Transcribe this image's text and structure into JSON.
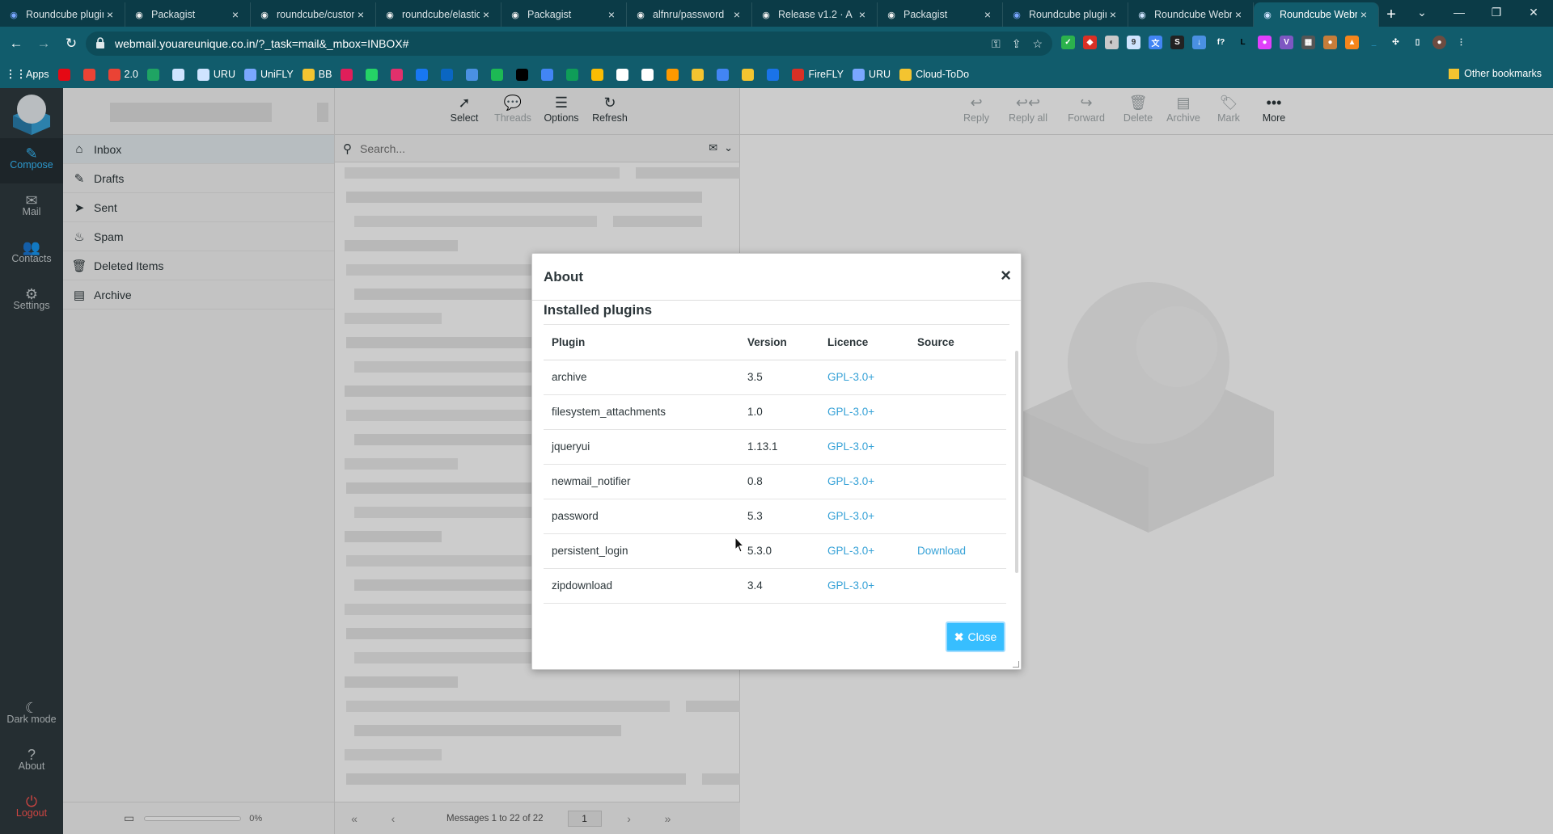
{
  "browser": {
    "tabs": [
      {
        "label": "Roundcube plugins",
        "color": "#7aa7ff"
      },
      {
        "label": "Packagist",
        "color": "#f2f2f2"
      },
      {
        "label": "roundcube/custom",
        "color": "#f2f2f2"
      },
      {
        "label": "roundcube/elastic",
        "color": "#f2f2f2"
      },
      {
        "label": "Packagist",
        "color": "#f2f2f2"
      },
      {
        "label": "alfnru/password",
        "color": "#f2f2f2"
      },
      {
        "label": "Release v1.2 · A",
        "color": "#f2f2f2"
      },
      {
        "label": "Packagist",
        "color": "#f2f2f2"
      },
      {
        "label": "Roundcube plugins",
        "color": "#7aa7ff"
      },
      {
        "label": "Roundcube Webmail",
        "color": "#cfe4ff"
      },
      {
        "label": "Roundcube Webmail",
        "color": "#cfe4ff"
      }
    ],
    "url": "webmail.youareunique.co.in/?_task=mail&_mbox=INBOX#",
    "bookmarks": [
      {
        "label": "Apps",
        "icon": "apps-icon",
        "color": "#ffffff"
      },
      {
        "label": "",
        "icon": "netflix-icon",
        "color": "#e50914"
      },
      {
        "label": "",
        "icon": "gmail-icon",
        "color": "#ea4335"
      },
      {
        "label": "2.0",
        "icon": "gmail-icon",
        "color": "#ea4335"
      },
      {
        "label": "",
        "icon": "drive-icon",
        "color": "#1fa463"
      },
      {
        "label": "",
        "icon": "roundcube-icon",
        "color": "#cfe4ff"
      },
      {
        "label": "URU",
        "icon": "roundcube-icon",
        "color": "#cfe4ff"
      },
      {
        "label": "UniFLY",
        "icon": "unifly-icon",
        "color": "#7aa7ff"
      },
      {
        "label": "BB",
        "icon": "folder-icon",
        "color": "#f4c430"
      },
      {
        "label": "",
        "icon": "slack-icon",
        "color": "#e01e5a"
      },
      {
        "label": "",
        "icon": "whatsapp-icon",
        "color": "#25d366"
      },
      {
        "label": "",
        "icon": "instagram-icon",
        "color": "#e1306c"
      },
      {
        "label": "",
        "icon": "facebook-icon",
        "color": "#1877f2"
      },
      {
        "label": "",
        "icon": "linkedin-icon",
        "color": "#0a66c2"
      },
      {
        "label": "",
        "icon": "screen-icon",
        "color": "#4a90e2"
      },
      {
        "label": "",
        "icon": "spotify-icon",
        "color": "#1db954"
      },
      {
        "label": "",
        "icon": "x-icon",
        "color": "#000000"
      },
      {
        "label": "",
        "icon": "docs-icon",
        "color": "#4285f4"
      },
      {
        "label": "",
        "icon": "sheets-icon",
        "color": "#0f9d58"
      },
      {
        "label": "",
        "icon": "photos-icon",
        "color": "#fbbc04"
      },
      {
        "label": "",
        "icon": "box-icon",
        "color": "#ffffff"
      },
      {
        "label": "",
        "icon": "github-icon",
        "color": "#ffffff"
      },
      {
        "label": "",
        "icon": "amazon-icon",
        "color": "#ff9900"
      },
      {
        "label": "",
        "icon": "pen-icon",
        "color": "#f4c430"
      },
      {
        "label": "",
        "icon": "translate-icon",
        "color": "#4285f4"
      },
      {
        "label": "",
        "icon": "photo-icon",
        "color": "#f4c430"
      },
      {
        "label": "",
        "icon": "chat-icon",
        "color": "#1a73e8"
      },
      {
        "label": "FireFLY",
        "icon": "firefly-icon",
        "color": "#d93025"
      },
      {
        "label": "URU",
        "icon": "unifly-icon",
        "color": "#7aa7ff"
      },
      {
        "label": "Cloud-ToDo",
        "icon": "folder-icon",
        "color": "#f4c430"
      }
    ],
    "other_bookmarks": "Other bookmarks"
  },
  "taskmenu": {
    "compose": "Compose",
    "mail": "Mail",
    "contacts": "Contacts",
    "settings": "Settings",
    "dark_mode": "Dark mode",
    "about": "About",
    "logout": "Logout"
  },
  "folders": [
    {
      "label": "Inbox",
      "icon": "inbox-icon",
      "glyph": "⌂"
    },
    {
      "label": "Drafts",
      "icon": "pencil-icon",
      "glyph": "✎"
    },
    {
      "label": "Sent",
      "icon": "paper-plane-icon",
      "glyph": "➤"
    },
    {
      "label": "Spam",
      "icon": "flame-icon",
      "glyph": "♨"
    },
    {
      "label": "Deleted Items",
      "icon": "trash-icon",
      "glyph": "🗑"
    },
    {
      "label": "Archive",
      "icon": "archive-icon",
      "glyph": "▤"
    }
  ],
  "quota": {
    "text": "0%",
    "fraction": 0
  },
  "list_toolbar": {
    "select": "Select",
    "threads": "Threads",
    "options": "Options",
    "refresh": "Refresh"
  },
  "search": {
    "placeholder": "Search..."
  },
  "list_footer": {
    "count": "Messages 1 to 22 of 22",
    "page": "1"
  },
  "message_toolbar": {
    "reply": "Reply",
    "reply_all": "Reply all",
    "forward": "Forward",
    "delete": "Delete",
    "archive": "Archive",
    "mark": "Mark",
    "more": "More"
  },
  "dialog": {
    "title": "About",
    "heading": "Installed plugins",
    "columns": {
      "plugin": "Plugin",
      "version": "Version",
      "licence": "Licence",
      "source": "Source"
    },
    "plugins": [
      {
        "name": "archive",
        "version": "3.5",
        "licence": "GPL-3.0+",
        "source": ""
      },
      {
        "name": "filesystem_attachments",
        "version": "1.0",
        "licence": "GPL-3.0+",
        "source": ""
      },
      {
        "name": "jqueryui",
        "version": "1.13.1",
        "licence": "GPL-3.0+",
        "source": ""
      },
      {
        "name": "newmail_notifier",
        "version": "0.8",
        "licence": "GPL-3.0+",
        "source": ""
      },
      {
        "name": "password",
        "version": "5.3",
        "licence": "GPL-3.0+",
        "source": ""
      },
      {
        "name": "persistent_login",
        "version": "5.3.0",
        "licence": "GPL-3.0+",
        "source": "Download"
      },
      {
        "name": "zipdownload",
        "version": "3.4",
        "licence": "GPL-3.0+",
        "source": ""
      }
    ],
    "close": "Close"
  },
  "colors": {
    "accent": "#37beff",
    "link": "#37a2d7",
    "taskmenu_bg": "#2f3a3f",
    "chrome_tab": "#0b3b47",
    "chrome_bar": "#115c6c",
    "logout": "#ff5552"
  }
}
